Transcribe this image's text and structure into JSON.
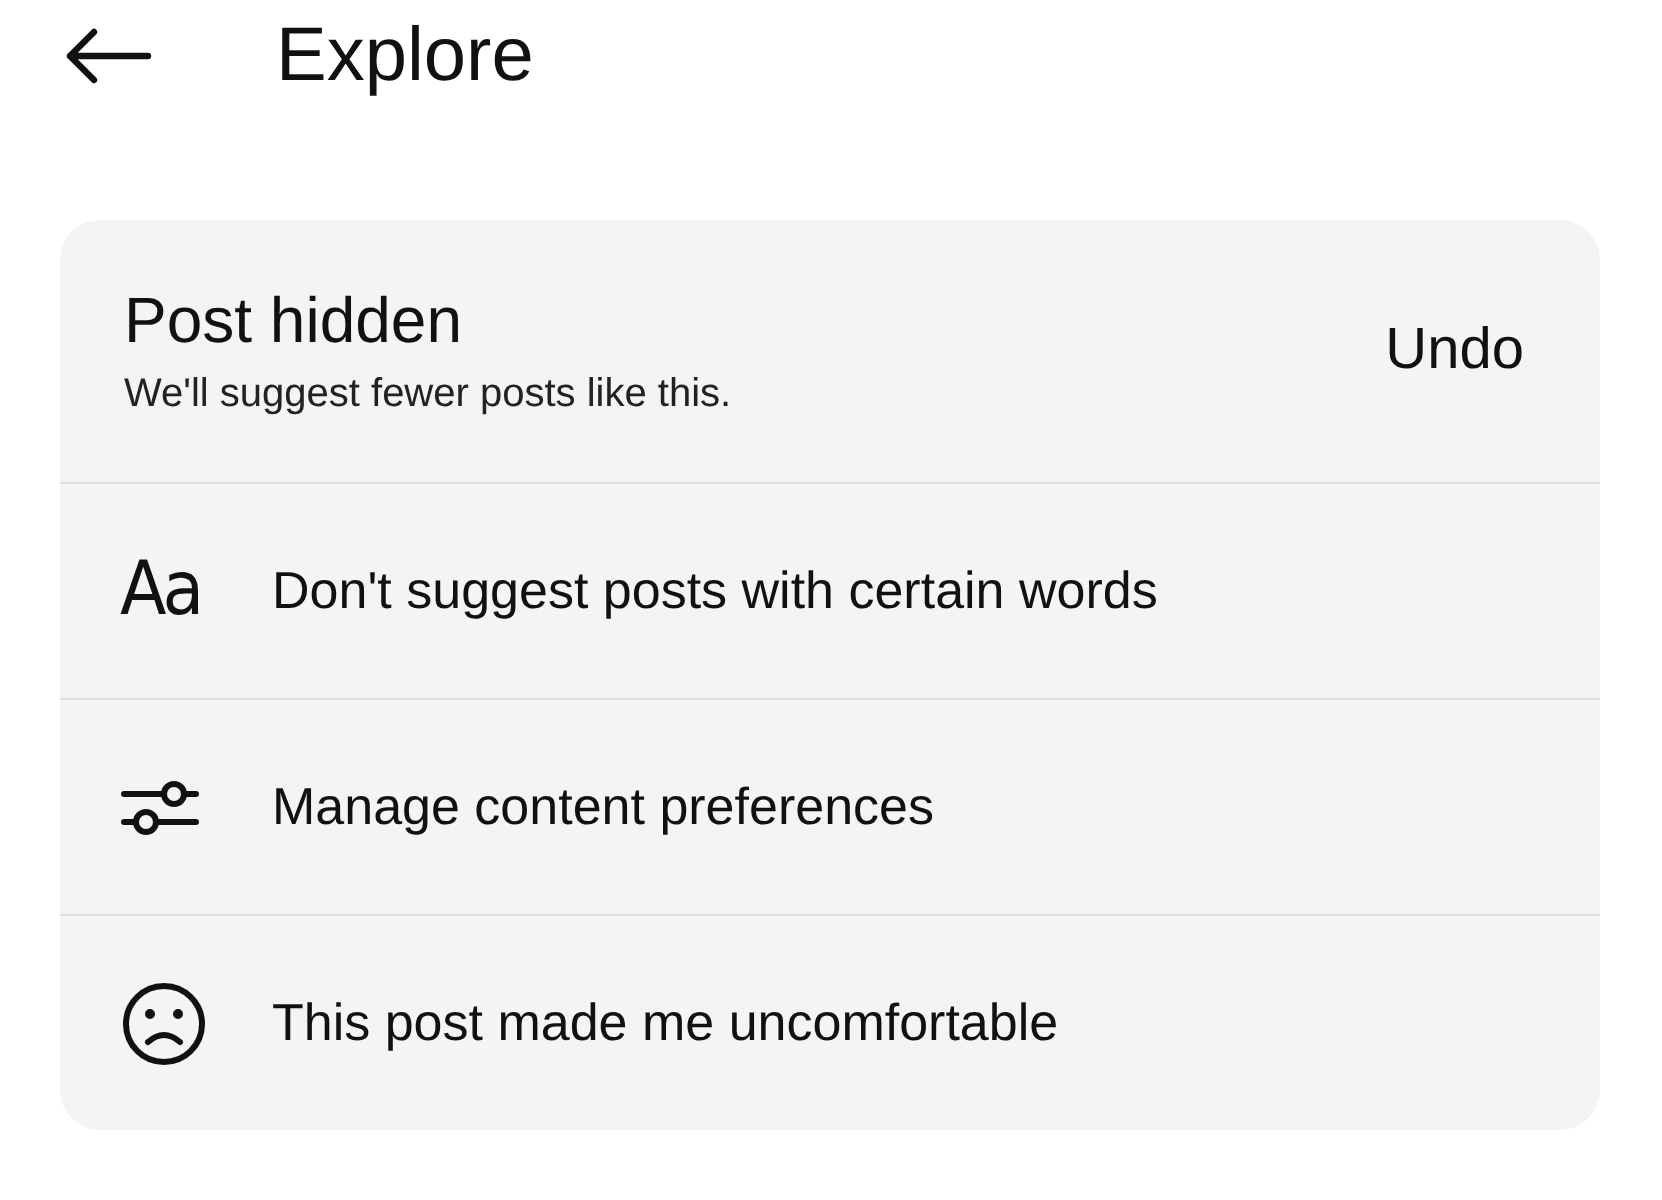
{
  "header": {
    "title": "Explore"
  },
  "notice": {
    "title": "Post hidden",
    "subtitle": "We'll suggest fewer posts like this.",
    "action": "Undo"
  },
  "options": [
    {
      "kind": "words",
      "icon_text": "Aa",
      "label": "Don't suggest posts with certain words"
    },
    {
      "kind": "preferences",
      "label": "Manage content preferences"
    },
    {
      "kind": "uncomfortable",
      "label": "This post made me uncomfortable"
    }
  ]
}
